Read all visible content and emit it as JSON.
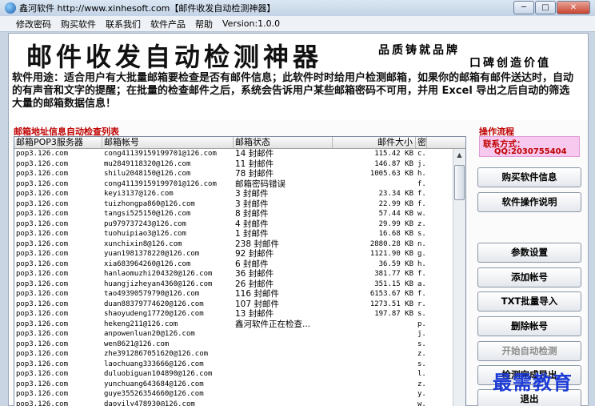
{
  "window": {
    "title": "鑫河软件 http://www.xinhesoft.com【邮件收发自动检测神器】",
    "buttons": {
      "minimize": "─",
      "maximize": "□",
      "close": "✕"
    }
  },
  "menu": [
    "修改密码",
    "购买软件",
    "联系我们",
    "软件产品",
    "帮助",
    "Version:1.0.0"
  ],
  "banner": {
    "title": "邮件收发自动检测神器",
    "slogan1": "品质铸就品牌",
    "slogan2": "口碑创造价值",
    "usage": "软件用途：适合用户有大批量邮箱要检查是否有邮件信息；此软件时时给用户检测邮箱，如果你的邮箱有邮件送达时，自动的有声音和文字的提醒；在批量的检查邮件之后，系统会告诉用户某些邮箱密码不可用，并用 Excel 导出之后自动的筛选大量的邮箱数据信息！"
  },
  "list": {
    "title": "邮箱地址信息自动检查列表",
    "columns": [
      "邮箱POP3服务器",
      "邮箱帐号",
      "邮箱状态",
      "邮件大小",
      "密"
    ],
    "rows": [
      [
        "pop3.126.com",
        "cong41139159199701@126.com",
        "14 封邮件",
        "115.42 KB",
        "c."
      ],
      [
        "pop3.126.com",
        "mu2849118320@126.com",
        "11 封邮件",
        "146.87 KB",
        "j."
      ],
      [
        "pop3.126.com",
        "shilu2048150@126.com",
        "78 封邮件",
        "1005.63 KB",
        "h."
      ],
      [
        "pop3.126.com",
        "cong41139159199701@126.com",
        "邮箱密码错误",
        "",
        "f."
      ],
      [
        "pop3.126.com",
        "keyi3137@126.com",
        "3 封邮件",
        "23.34 KB",
        "f."
      ],
      [
        "pop3.126.com",
        "tuizhongpa860@126.com",
        "3 封邮件",
        "22.99 KB",
        "f."
      ],
      [
        "pop3.126.com",
        "tangsi525150@126.com",
        "8 封邮件",
        "57.44 KB",
        "w."
      ],
      [
        "pop3.126.com",
        "pu979737243@126.com",
        "4 封邮件",
        "29.99 KB",
        "z."
      ],
      [
        "pop3.126.com",
        "tuohuipiao3@126.com",
        "1 封邮件",
        "16.68 KB",
        "s."
      ],
      [
        "pop3.126.com",
        "xunchixin8@126.com",
        "238 封邮件",
        "2880.28 KB",
        "n."
      ],
      [
        "pop3.126.com",
        "yuan1981378220@126.com",
        "92 封邮件",
        "1121.90 KB",
        "g."
      ],
      [
        "pop3.126.com",
        "xia683964260@126.com",
        "6 封邮件",
        "36.59 KB",
        "h."
      ],
      [
        "pop3.126.com",
        "hanlaomuzhi204320@126.com",
        "36 封邮件",
        "381.77 KB",
        "f."
      ],
      [
        "pop3.126.com",
        "huangjizheyan4360@126.com",
        "26 封邮件",
        "351.15 KB",
        "a."
      ],
      [
        "pop3.126.com",
        "tao49390579790@126.com",
        "116 封邮件",
        "6153.67 KB",
        "f."
      ],
      [
        "pop3.126.com",
        "duan88379774620@126.com",
        "107 封邮件",
        "1273.51 KB",
        "r."
      ],
      [
        "pop3.126.com",
        "shaoyudeng17720@126.com",
        "13 封邮件",
        "197.87 KB",
        "s."
      ],
      [
        "pop3.126.com",
        "hekeng211@126.com",
        "鑫河软件正在检查...",
        "",
        "p."
      ],
      [
        "pop3.126.com",
        "anpowenluan20@126.com",
        "",
        "",
        "j."
      ],
      [
        "pop3.126.com",
        "wen8621@126.com",
        "",
        "",
        "s."
      ],
      [
        "pop3.126.com",
        "zhe3912867051620@126.com",
        "",
        "",
        "z."
      ],
      [
        "pop3.126.com",
        "laochuang333666@126.com",
        "",
        "",
        "s."
      ],
      [
        "pop3.126.com",
        "duluobiguan104890@126.com",
        "",
        "",
        "l."
      ],
      [
        "pop3.126.com",
        "yunchuang643684@126.com",
        "",
        "",
        "z."
      ],
      [
        "pop3.126.com",
        "guye35526354660@126.com",
        "",
        "",
        "y."
      ],
      [
        "pop3.126.com",
        "daoyily478930@126.com",
        "",
        "",
        "w."
      ]
    ]
  },
  "panel": {
    "title": "操作流程",
    "contact_label": "联系方式：",
    "contact_qq": "QQ:2030755404",
    "buttons": {
      "buy": "购买软件信息",
      "manual": "软件操作说明",
      "settings": "参数设置",
      "add": "添加帐号",
      "import": "TXT批量导入",
      "delete": "删除帐号",
      "start": "开始自动检测",
      "export": "检测完成导出",
      "exit": "退出"
    }
  },
  "watermark": "最需教育"
}
